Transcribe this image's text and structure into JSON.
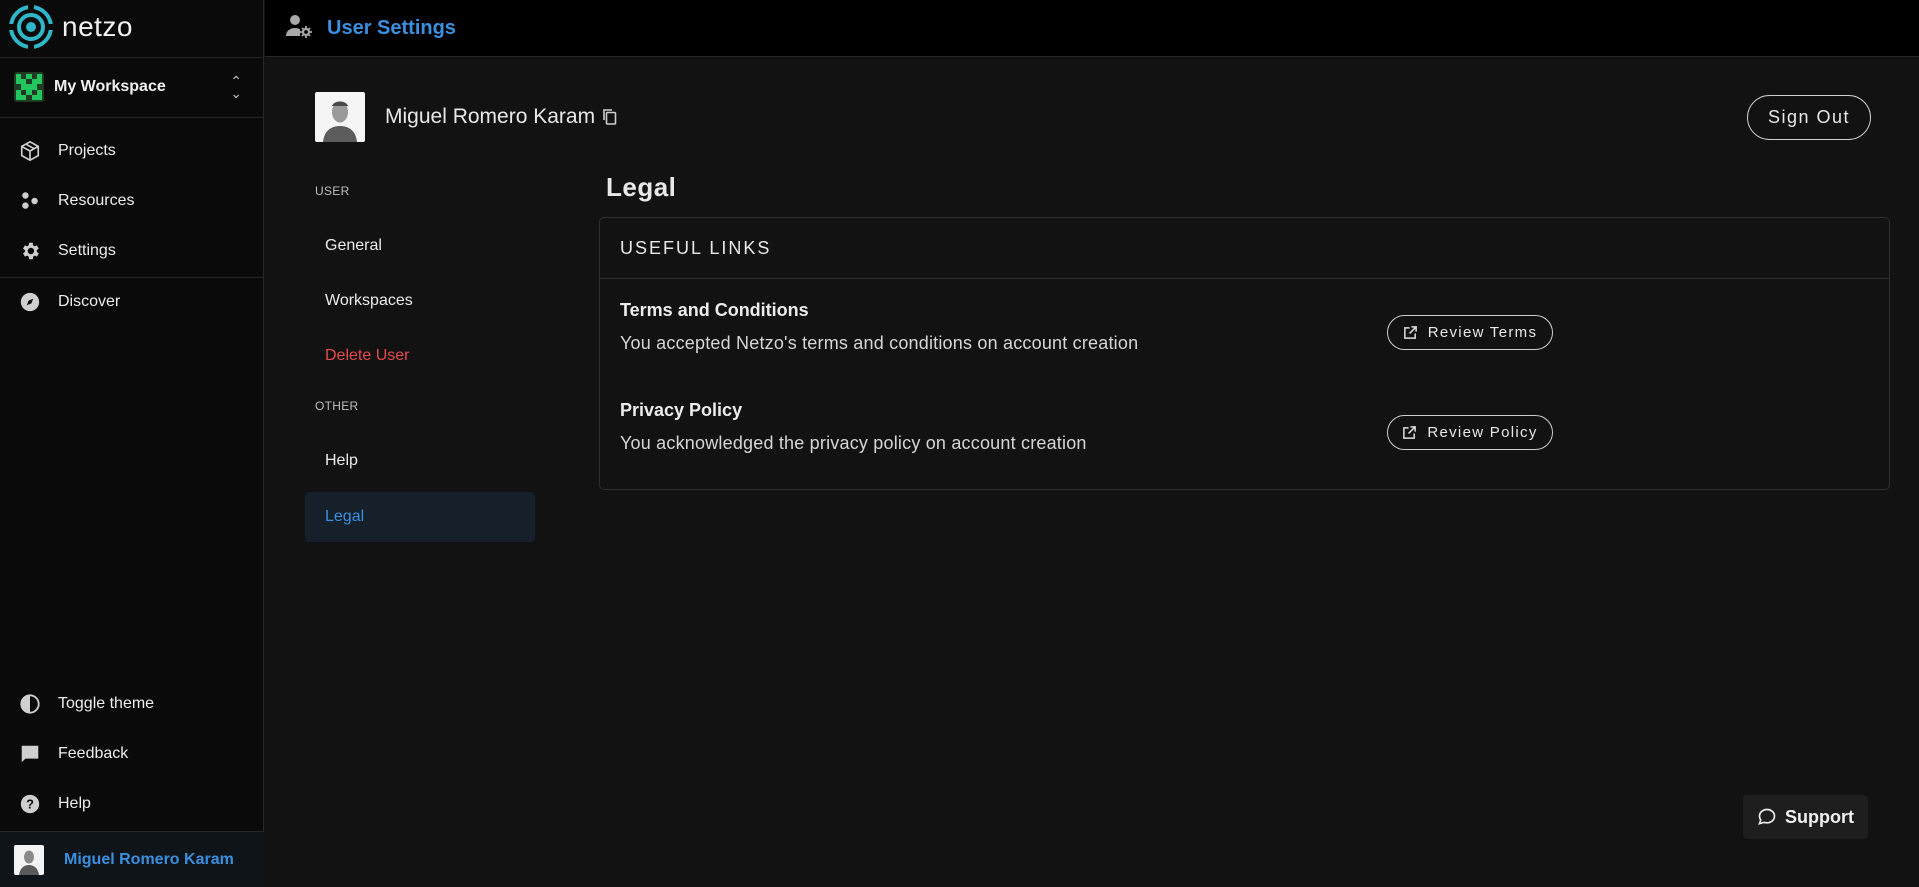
{
  "app": {
    "name": "netzo"
  },
  "sidebar": {
    "workspace": {
      "label": "My Workspace"
    },
    "nav": [
      {
        "label": "Projects",
        "icon": "box-icon"
      },
      {
        "label": "Resources",
        "icon": "resources-icon"
      },
      {
        "label": "Settings",
        "icon": "gear-icon"
      },
      {
        "label": "Discover",
        "icon": "compass-icon"
      }
    ],
    "bottom": [
      {
        "label": "Toggle theme",
        "icon": "contrast-icon"
      },
      {
        "label": "Feedback",
        "icon": "message-icon"
      },
      {
        "label": "Help",
        "icon": "help-icon"
      }
    ],
    "user": {
      "name": "Miguel Romero Karam"
    }
  },
  "topbar": {
    "title": "User Settings",
    "icon": "user-settings-icon"
  },
  "profile": {
    "name": "Miguel Romero Karam",
    "signout_label": "Sign Out"
  },
  "settings_nav": {
    "user_section": "USER",
    "user_items": [
      "General",
      "Workspaces",
      "Delete User"
    ],
    "other_section": "OTHER",
    "other_items": [
      "Help",
      "Legal"
    ],
    "active": "Legal"
  },
  "content": {
    "title": "Legal",
    "card_title": "USEFUL LINKS",
    "rows": [
      {
        "title": "Terms and Conditions",
        "description": "You accepted Netzo's terms and conditions on account creation",
        "button": "Review Terms"
      },
      {
        "title": "Privacy Policy",
        "description": "You acknowledged the privacy policy on account creation",
        "button": "Review Policy"
      }
    ]
  },
  "support": {
    "label": "Support"
  },
  "colors": {
    "accent": "#3b8fe0",
    "danger": "#e5484d",
    "background": "#121212",
    "sidebar": "#0a0a0a"
  }
}
